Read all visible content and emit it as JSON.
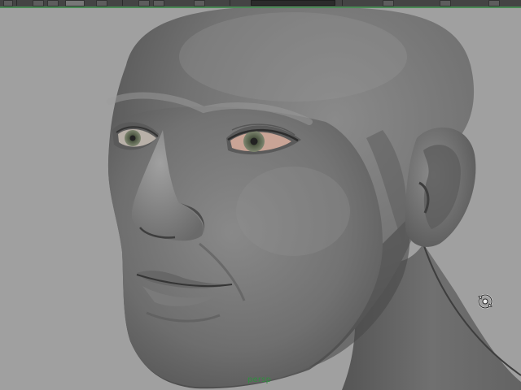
{
  "viewport": {
    "camera_name": "persp",
    "background_color": "#a0a0a0",
    "model_description_icon": "head-model",
    "orbit_icon": "camera-orbit-icon"
  },
  "toolbar": {
    "background_color": "#444444",
    "accent_color": "#4a8a55"
  }
}
